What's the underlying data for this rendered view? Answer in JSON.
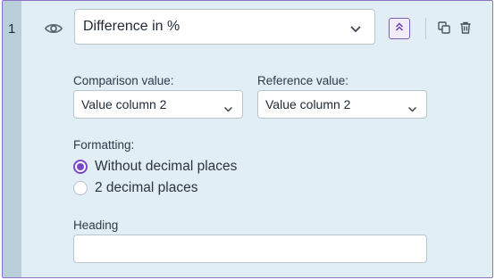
{
  "row": {
    "number": "1"
  },
  "icons": {
    "visibility": "eye-icon",
    "dropdown": "chevron-down-icon",
    "collapse": "chevrons-up-icon",
    "duplicate": "copy-icon",
    "delete": "trash-icon"
  },
  "type_select": {
    "value": "Difference in %"
  },
  "comparison": {
    "label": "Comparison value:",
    "value": "Value column 2"
  },
  "reference": {
    "label": "Reference value:",
    "value": "Value column 2"
  },
  "formatting": {
    "label": "Formatting:",
    "options": [
      {
        "label": "Without decimal places",
        "selected": true
      },
      {
        "label": "2 decimal places",
        "selected": false
      }
    ]
  },
  "heading": {
    "label": "Heading",
    "value": ""
  },
  "colors": {
    "accent": "#7a47c9",
    "panel": "#e2eef5",
    "gutter": "#b9d0da",
    "border": "#8a72c4"
  }
}
